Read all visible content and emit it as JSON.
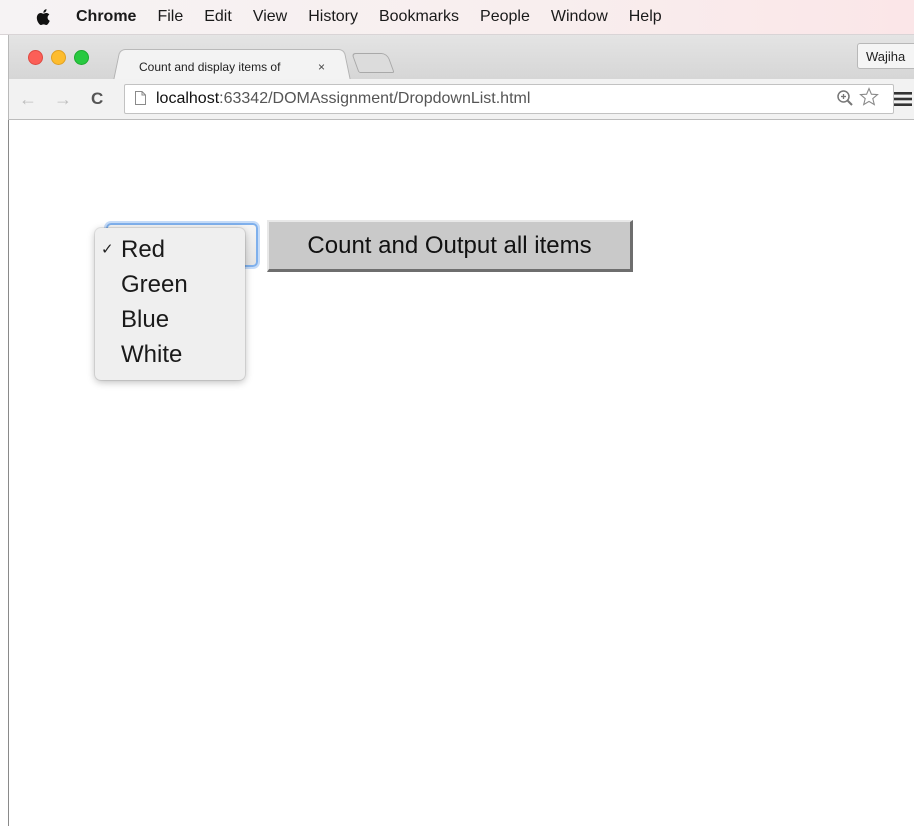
{
  "menubar": {
    "app_name": "Chrome",
    "items": [
      "File",
      "Edit",
      "View",
      "History",
      "Bookmarks",
      "People",
      "Window",
      "Help"
    ]
  },
  "tab": {
    "title": "Count and display items of",
    "close_glyph": "×"
  },
  "profile": {
    "name": "Wajiha"
  },
  "toolbar": {
    "back_glyph": "←",
    "forward_glyph": "→",
    "reload_glyph": "C",
    "url_host": "localhost",
    "url_rest": ":63342/DOMAssignment/DropdownList.html"
  },
  "page": {
    "button_label": "Count and Output all items",
    "dropdown": {
      "selected": "Red",
      "check_glyph": "✓",
      "options": [
        "Red",
        "Green",
        "Blue",
        "White"
      ]
    }
  },
  "icons": {
    "apple": "apple-icon",
    "page": "page-icon",
    "zoom": "zoom-icon",
    "star": "star-icon",
    "menu": "menu-icon"
  }
}
